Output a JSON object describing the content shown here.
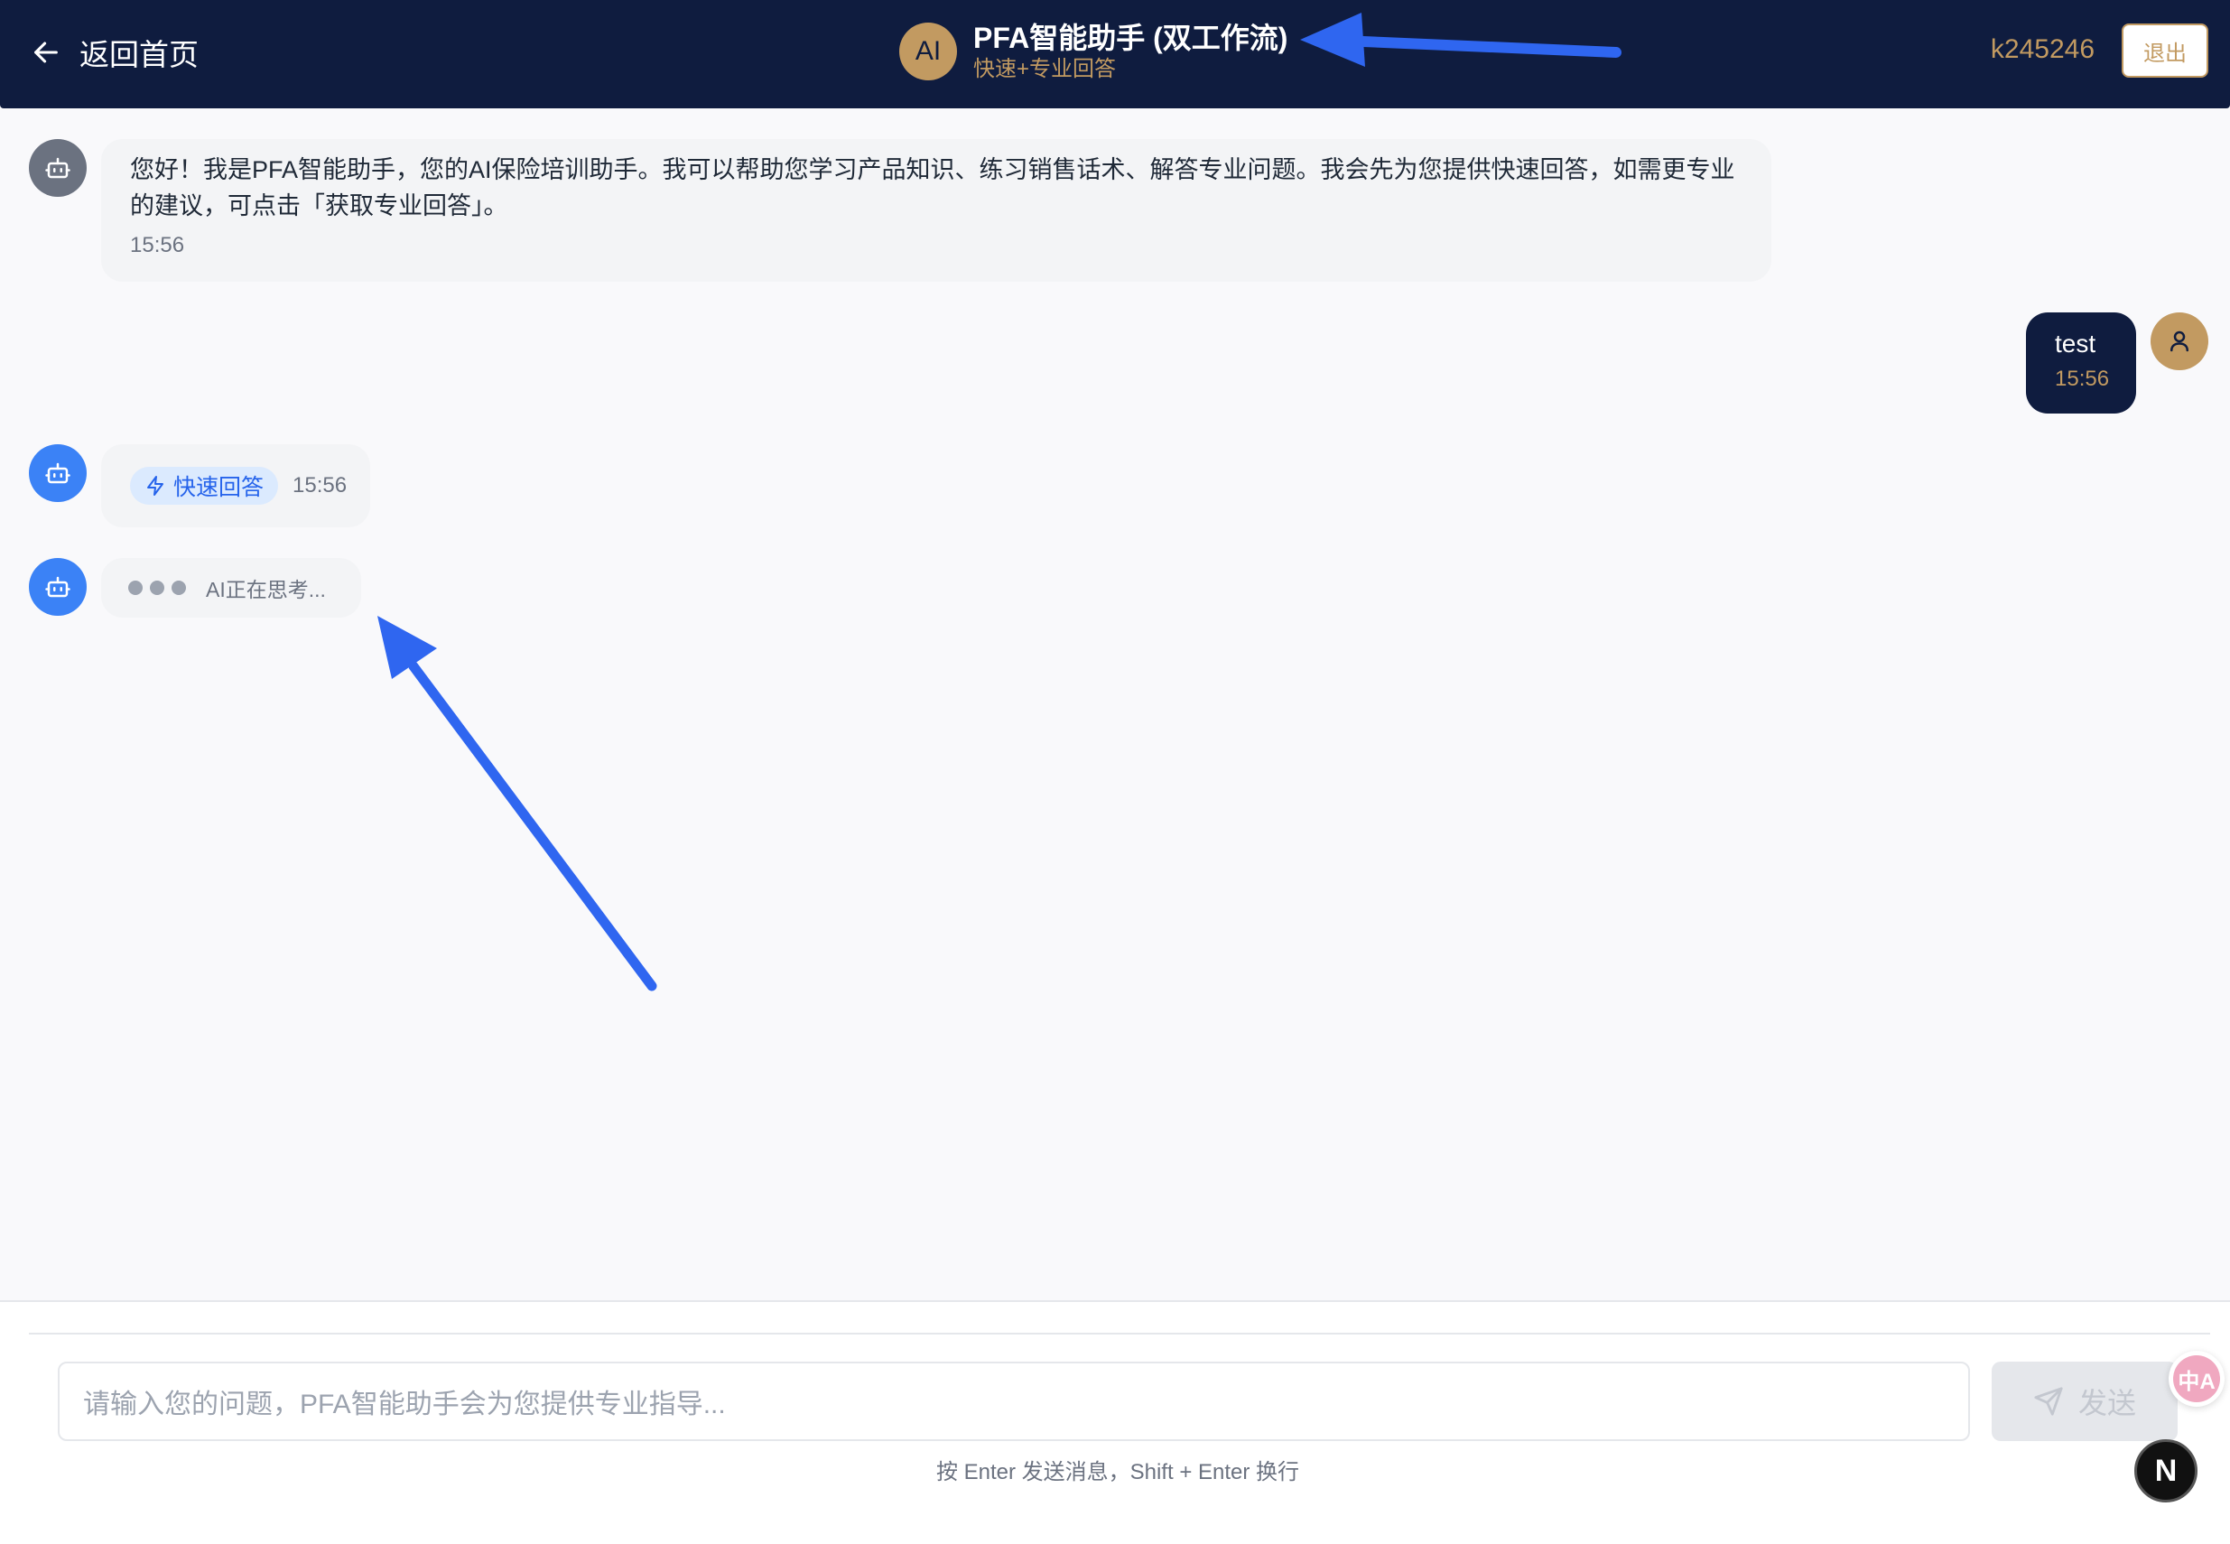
{
  "header": {
    "back_label": "返回首页",
    "avatar_text": "AI",
    "title": "PFA智能助手 (双工作流)",
    "subtitle": "快速+专业回答",
    "username": "k245246",
    "logout_label": "退出"
  },
  "messages": [
    {
      "role": "assistant",
      "text": "您好！我是PFA智能助手，您的AI保险培训助手。我可以帮助您学习产品知识、练习销售话术、解答专业问题。我会先为您提供快速回答，如需更专业的建议，可点击「获取专业回答」。",
      "time": "15:56"
    },
    {
      "role": "user",
      "text": "test",
      "time": "15:56"
    },
    {
      "role": "assistant",
      "badge": "快速回答",
      "time": "15:56"
    },
    {
      "role": "assistant",
      "status": "AI正在思考..."
    }
  ],
  "composer": {
    "placeholder": "请输入您的问题，PFA智能助手会为您提供专业指导...",
    "send_label": "发送",
    "hint": "按 Enter 发送消息，Shift + Enter 换行"
  },
  "widgets": {
    "translate_text": "中A",
    "next_badge_text": "N"
  },
  "colors": {
    "header_bg": "#0f1c3f",
    "accent_gold": "#c29a61",
    "bot_blue": "#3b82f6",
    "annotation_arrow": "#2f66f0"
  },
  "icons": [
    "arrow-left-icon",
    "robot-icon",
    "user-icon",
    "lightning-icon",
    "send-icon",
    "translate-icon"
  ]
}
